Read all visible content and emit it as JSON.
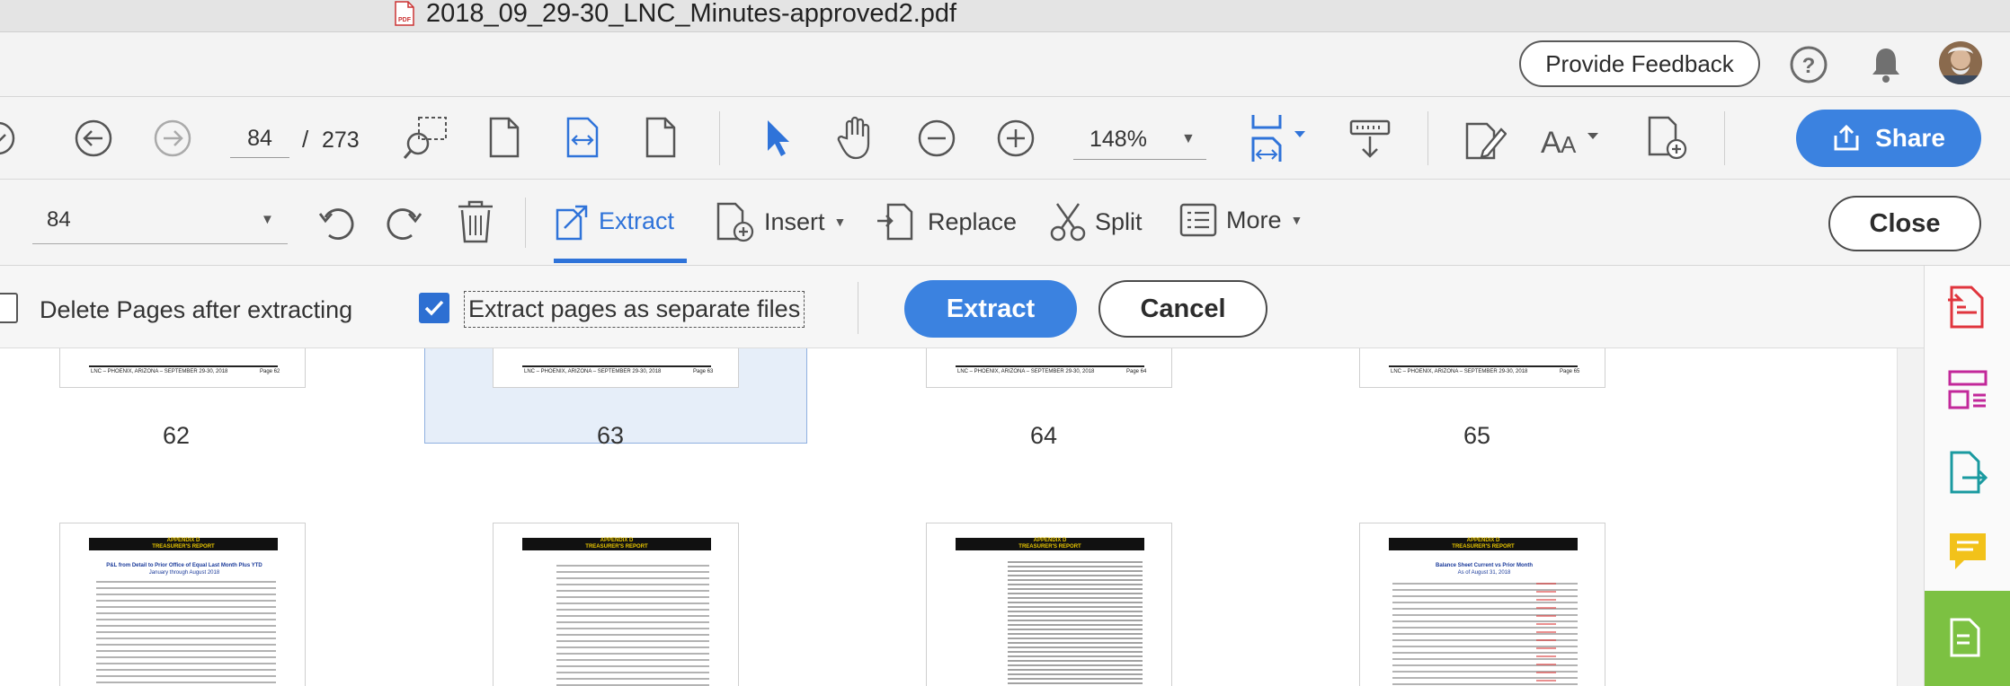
{
  "window": {
    "title": "2018_09_29-30_LNC_Minutes-approved2.pdf",
    "file_icon": "pdf-file-icon"
  },
  "topbar": {
    "feedback_label": "Provide Feedback",
    "help_icon": "help-icon",
    "bell_icon": "bell-icon",
    "avatar_icon": "avatar"
  },
  "toolbar": {
    "current_page": "84",
    "page_sep": "/",
    "total_pages": "273",
    "zoom": "148%",
    "share_label": "Share",
    "accent": "#3b82e0"
  },
  "organize": {
    "page_select_value": "84",
    "extract_label": "Extract",
    "insert_label": "Insert",
    "replace_label": "Replace",
    "split_label": "Split",
    "more_label": "More",
    "close_label": "Close"
  },
  "extract_options": {
    "delete_label": "Delete Pages after extracting",
    "delete_checked": false,
    "separate_label": "Extract pages as separate files",
    "separate_checked": true,
    "extract_button": "Extract",
    "cancel_button": "Cancel"
  },
  "pages_row1": [
    {
      "num": "62",
      "footer_left": "LNC – PHOENIX, ARIZONA – SEPTEMBER 29-30, 2018",
      "footer_right": "Page 62",
      "selected": false
    },
    {
      "num": "63",
      "footer_left": "LNC – PHOENIX, ARIZONA – SEPTEMBER 29-30, 2018",
      "footer_right": "Page 63",
      "selected": true
    },
    {
      "num": "64",
      "footer_left": "LNC – PHOENIX, ARIZONA – SEPTEMBER 29-30, 2018",
      "footer_right": "Page 64",
      "selected": false
    },
    {
      "num": "65",
      "footer_left": "LNC – PHOENIX, ARIZONA – SEPTEMBER 29-30, 2018",
      "footer_right": "Page 65",
      "selected": false
    }
  ],
  "pages_row2": [
    {
      "banner1": "APPENDIX D",
      "banner2": "TREASURER'S REPORT",
      "heading1": "P&L from Detail to Prior Office of Equal Last Month Plus YTD",
      "heading2": "January through August 2018"
    },
    {
      "banner1": "APPENDIX D",
      "banner2": "TREASURER'S REPORT"
    },
    {
      "banner1": "APPENDIX D",
      "banner2": "TREASURER'S REPORT"
    },
    {
      "banner1": "APPENDIX D",
      "banner2": "TREASURER'S REPORT",
      "heading1": "Balance Sheet Current vs Prior Month",
      "heading2": "As of August 31, 2018"
    }
  ],
  "right_rail": [
    "export-pdf-icon",
    "organize-pages-icon",
    "send-file-icon",
    "comment-icon",
    "more-tools-icon"
  ]
}
